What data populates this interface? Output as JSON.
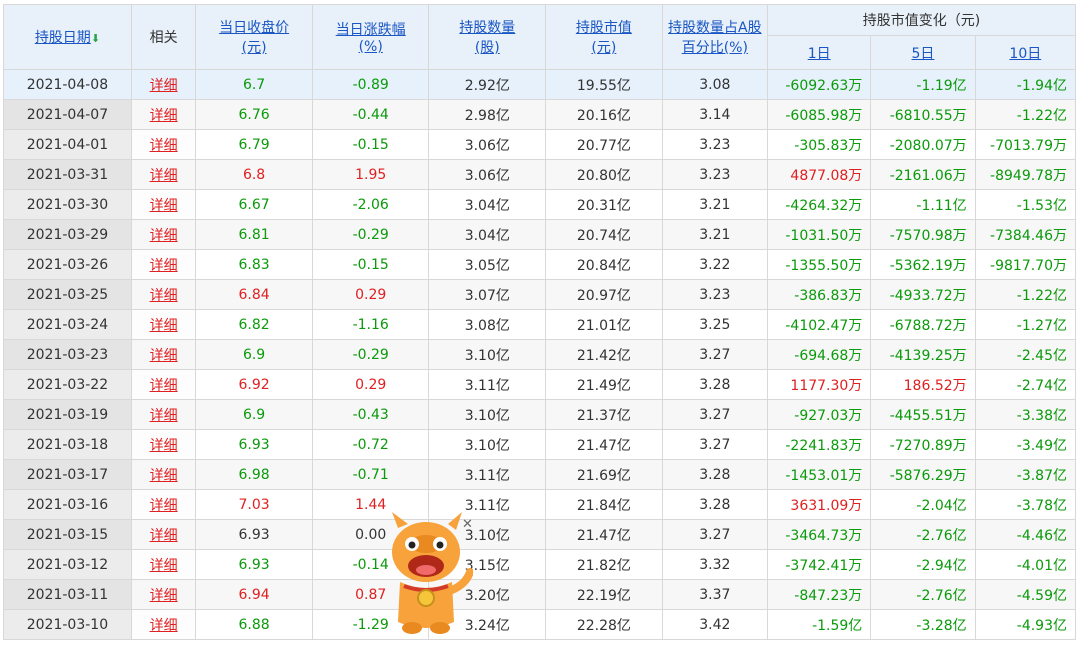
{
  "header": {
    "date": "持股日期",
    "related": "相关",
    "close_price_l1": "当日收盘价",
    "close_price_l2": "(元)",
    "change_l1": "当日涨跌幅",
    "change_l2": "(%)",
    "hold_qty_l1": "持股数量",
    "hold_qty_l2": "(股)",
    "hold_value_l1": "持股市值",
    "hold_value_l2": "(元)",
    "hold_pct_l1": "持股数量占A股",
    "hold_pct_l2": "百分比(%)",
    "value_change": "持股市值变化（元)",
    "d1": "1日",
    "d5": "5日",
    "d10": "10日"
  },
  "rows": [
    {
      "date": "2021-04-08",
      "link": "详细",
      "close": "6.7",
      "chg": "-0.89",
      "qty": "2.92亿",
      "val": "19.55亿",
      "pct": "3.08",
      "c1": "-6092.63万",
      "c5": "-1.19亿",
      "c10": "-1.94亿",
      "cc": "g",
      "chc": "g",
      "c1c": "g",
      "c5c": "g",
      "c10c": "g"
    },
    {
      "date": "2021-04-07",
      "link": "详细",
      "close": "6.76",
      "chg": "-0.44",
      "qty": "2.98亿",
      "val": "20.16亿",
      "pct": "3.14",
      "c1": "-6085.98万",
      "c5": "-6810.55万",
      "c10": "-1.22亿",
      "cc": "g",
      "chc": "g",
      "c1c": "g",
      "c5c": "g",
      "c10c": "g"
    },
    {
      "date": "2021-04-01",
      "link": "详细",
      "close": "6.79",
      "chg": "-0.15",
      "qty": "3.06亿",
      "val": "20.77亿",
      "pct": "3.23",
      "c1": "-305.83万",
      "c5": "-2080.07万",
      "c10": "-7013.79万",
      "cc": "g",
      "chc": "g",
      "c1c": "g",
      "c5c": "g",
      "c10c": "g"
    },
    {
      "date": "2021-03-31",
      "link": "详细",
      "close": "6.8",
      "chg": "1.95",
      "qty": "3.06亿",
      "val": "20.80亿",
      "pct": "3.23",
      "c1": "4877.08万",
      "c5": "-2161.06万",
      "c10": "-8949.78万",
      "cc": "r",
      "chc": "r",
      "c1c": "r",
      "c5c": "g",
      "c10c": "g"
    },
    {
      "date": "2021-03-30",
      "link": "详细",
      "close": "6.67",
      "chg": "-2.06",
      "qty": "3.04亿",
      "val": "20.31亿",
      "pct": "3.21",
      "c1": "-4264.32万",
      "c5": "-1.11亿",
      "c10": "-1.53亿",
      "cc": "g",
      "chc": "g",
      "c1c": "g",
      "c5c": "g",
      "c10c": "g"
    },
    {
      "date": "2021-03-29",
      "link": "详细",
      "close": "6.81",
      "chg": "-0.29",
      "qty": "3.04亿",
      "val": "20.74亿",
      "pct": "3.21",
      "c1": "-1031.50万",
      "c5": "-7570.98万",
      "c10": "-7384.46万",
      "cc": "g",
      "chc": "g",
      "c1c": "g",
      "c5c": "g",
      "c10c": "g"
    },
    {
      "date": "2021-03-26",
      "link": "详细",
      "close": "6.83",
      "chg": "-0.15",
      "qty": "3.05亿",
      "val": "20.84亿",
      "pct": "3.22",
      "c1": "-1355.50万",
      "c5": "-5362.19万",
      "c10": "-9817.70万",
      "cc": "g",
      "chc": "g",
      "c1c": "g",
      "c5c": "g",
      "c10c": "g"
    },
    {
      "date": "2021-03-25",
      "link": "详细",
      "close": "6.84",
      "chg": "0.29",
      "qty": "3.07亿",
      "val": "20.97亿",
      "pct": "3.23",
      "c1": "-386.83万",
      "c5": "-4933.72万",
      "c10": "-1.22亿",
      "cc": "r",
      "chc": "r",
      "c1c": "g",
      "c5c": "g",
      "c10c": "g"
    },
    {
      "date": "2021-03-24",
      "link": "详细",
      "close": "6.82",
      "chg": "-1.16",
      "qty": "3.08亿",
      "val": "21.01亿",
      "pct": "3.25",
      "c1": "-4102.47万",
      "c5": "-6788.72万",
      "c10": "-1.27亿",
      "cc": "g",
      "chc": "g",
      "c1c": "g",
      "c5c": "g",
      "c10c": "g"
    },
    {
      "date": "2021-03-23",
      "link": "详细",
      "close": "6.9",
      "chg": "-0.29",
      "qty": "3.10亿",
      "val": "21.42亿",
      "pct": "3.27",
      "c1": "-694.68万",
      "c5": "-4139.25万",
      "c10": "-2.45亿",
      "cc": "g",
      "chc": "g",
      "c1c": "g",
      "c5c": "g",
      "c10c": "g"
    },
    {
      "date": "2021-03-22",
      "link": "详细",
      "close": "6.92",
      "chg": "0.29",
      "qty": "3.11亿",
      "val": "21.49亿",
      "pct": "3.28",
      "c1": "1177.30万",
      "c5": "186.52万",
      "c10": "-2.74亿",
      "cc": "r",
      "chc": "r",
      "c1c": "r",
      "c5c": "r",
      "c10c": "g"
    },
    {
      "date": "2021-03-19",
      "link": "详细",
      "close": "6.9",
      "chg": "-0.43",
      "qty": "3.10亿",
      "val": "21.37亿",
      "pct": "3.27",
      "c1": "-927.03万",
      "c5": "-4455.51万",
      "c10": "-3.38亿",
      "cc": "g",
      "chc": "g",
      "c1c": "g",
      "c5c": "g",
      "c10c": "g"
    },
    {
      "date": "2021-03-18",
      "link": "详细",
      "close": "6.93",
      "chg": "-0.72",
      "qty": "3.10亿",
      "val": "21.47亿",
      "pct": "3.27",
      "c1": "-2241.83万",
      "c5": "-7270.89万",
      "c10": "-3.49亿",
      "cc": "g",
      "chc": "g",
      "c1c": "g",
      "c5c": "g",
      "c10c": "g"
    },
    {
      "date": "2021-03-17",
      "link": "详细",
      "close": "6.98",
      "chg": "-0.71",
      "qty": "3.11亿",
      "val": "21.69亿",
      "pct": "3.28",
      "c1": "-1453.01万",
      "c5": "-5876.29万",
      "c10": "-3.87亿",
      "cc": "g",
      "chc": "g",
      "c1c": "g",
      "c5c": "g",
      "c10c": "g"
    },
    {
      "date": "2021-03-16",
      "link": "详细",
      "close": "7.03",
      "chg": "1.44",
      "qty": "3.11亿",
      "val": "21.84亿",
      "pct": "3.28",
      "c1": "3631.09万",
      "c5": "-2.04亿",
      "c10": "-3.78亿",
      "cc": "r",
      "chc": "r",
      "c1c": "r",
      "c5c": "g",
      "c10c": "g"
    },
    {
      "date": "2021-03-15",
      "link": "详细",
      "close": "6.93",
      "chg": "0.00",
      "qty": "3.10亿",
      "val": "21.47亿",
      "pct": "3.27",
      "c1": "-3464.73万",
      "c5": "-2.76亿",
      "c10": "-4.46亿",
      "cc": "k",
      "chc": "k",
      "c1c": "g",
      "c5c": "g",
      "c10c": "g"
    },
    {
      "date": "2021-03-12",
      "link": "详细",
      "close": "6.93",
      "chg": "-0.14",
      "qty": "3.15亿",
      "val": "21.82亿",
      "pct": "3.32",
      "c1": "-3742.41万",
      "c5": "-2.94亿",
      "c10": "-4.01亿",
      "cc": "g",
      "chc": "g",
      "c1c": "g",
      "c5c": "g",
      "c10c": "g"
    },
    {
      "date": "2021-03-11",
      "link": "详细",
      "close": "6.94",
      "chg": "0.87",
      "qty": "3.20亿",
      "val": "22.19亿",
      "pct": "3.37",
      "c1": "-847.23万",
      "c5": "-2.76亿",
      "c10": "-4.59亿",
      "cc": "r",
      "chc": "r",
      "c1c": "g",
      "c5c": "g",
      "c10c": "g"
    },
    {
      "date": "2021-03-10",
      "link": "详细",
      "close": "6.88",
      "chg": "-1.29",
      "qty": "3.24亿",
      "val": "22.28亿",
      "pct": "3.42",
      "c1": "-1.59亿",
      "c5": "-3.28亿",
      "c10": "-4.93亿",
      "cc": "g",
      "chc": "g",
      "c1c": "g",
      "c5c": "g",
      "c10c": "g"
    }
  ],
  "colors": {
    "up": "#e02020",
    "down": "#0a9a0a",
    "link": "#1a56c4"
  },
  "icons": {
    "sort": "arrow-down-icon",
    "mascot": "bull-mascot-icon",
    "close": "close-icon"
  }
}
